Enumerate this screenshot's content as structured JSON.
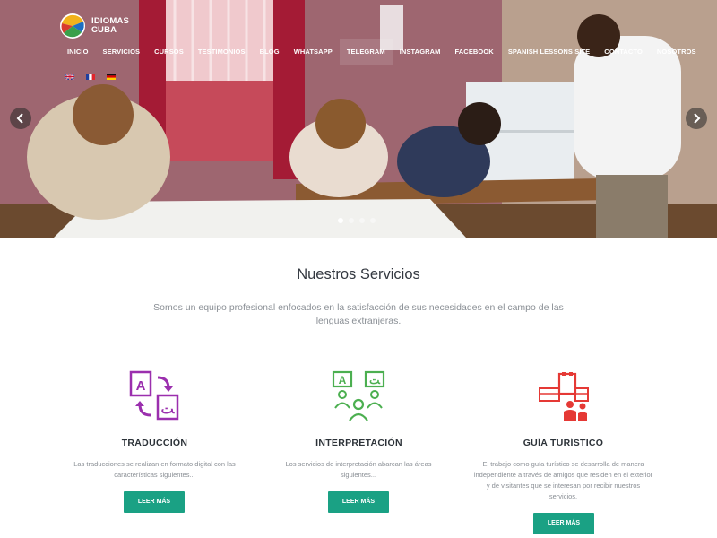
{
  "brand": {
    "name_line1": "IDIOMAS",
    "name_line2": "CUBA"
  },
  "nav": {
    "items": [
      {
        "label": "INICIO"
      },
      {
        "label": "SERVICIOS"
      },
      {
        "label": "CURSOS"
      },
      {
        "label": "TESTIMONIOS"
      },
      {
        "label": "BLOG"
      },
      {
        "label": "WHATSAPP"
      },
      {
        "label": "TELEGRAM"
      },
      {
        "label": "INSTAGRAM"
      },
      {
        "label": "FACEBOOK"
      },
      {
        "label": "SPANISH LESSONS SITE"
      },
      {
        "label": "CONTACTO"
      },
      {
        "label": "NOSOTROS"
      }
    ]
  },
  "languages": [
    "english-flag",
    "french-flag",
    "german-flag"
  ],
  "slider": {
    "dots": 4,
    "active_dot": 0
  },
  "services": {
    "title": "Nuestros Servicios",
    "subtitle": "Somos un equipo profesional enfocados en la satisfacción de sus necesidades en el campo de las lenguas extranjeras.",
    "cards": [
      {
        "icon": "translation-icon",
        "title": "TRADUCCIÓN",
        "text": "Las traducciones se realizan en formato digital con las características siguientes...",
        "button": "LEER MÁS"
      },
      {
        "icon": "interpretation-icon",
        "title": "INTERPRETACIÓN",
        "text": "Los servicios de interpretación abarcan las áreas siguientes...",
        "button": "LEER MÁS"
      },
      {
        "icon": "tour-guide-icon",
        "title": "GUÍA TURÍSTICO",
        "text": "El trabajo como guía turístico se desarrolla de manera independiente a través de amigos que residen en el exterior y de visitantes que se interesan por recibir nuestros servicios.",
        "button": "LEER MÁS"
      }
    ]
  },
  "colors": {
    "accent": "#1aa184",
    "translation_icon": "#9b2fae",
    "interpretation_icon": "#4caf50",
    "tour_icon": "#e53935"
  }
}
